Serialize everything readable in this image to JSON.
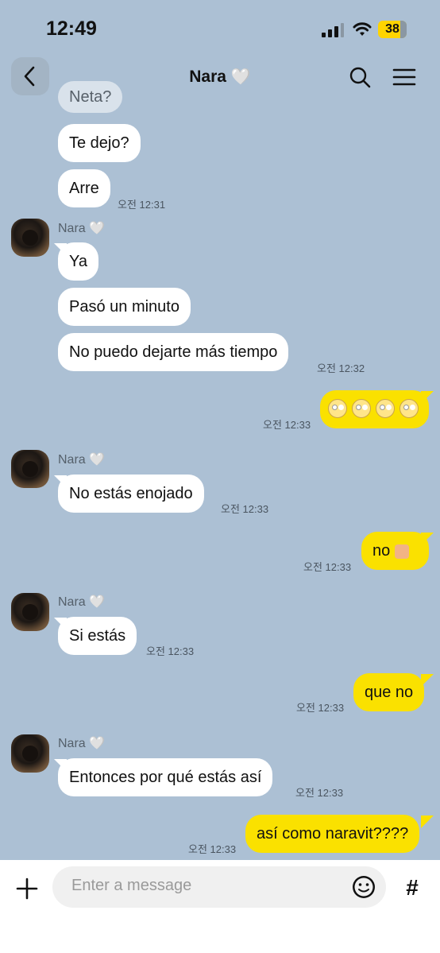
{
  "status": {
    "time": "12:49",
    "battery": "38"
  },
  "header": {
    "title": "Nara",
    "heart": "🤍"
  },
  "contact": {
    "name": "Nara",
    "heart": "🤍"
  },
  "messages": [
    {
      "text": "Neta?"
    },
    {
      "text": "Te dejo?"
    },
    {
      "text": "Arre",
      "time": "오전 12:31"
    },
    {
      "text": "Ya"
    },
    {
      "text": "Pasó un minuto"
    },
    {
      "text": "No puedo dejarte más tiempo",
      "time": "오전 12:32"
    },
    {
      "text": "🙄🙄🙄🙄",
      "time": "오전 12:33"
    },
    {
      "text": "No estás enojado",
      "time": "오전 12:33"
    },
    {
      "text": "no",
      "emoji": "👎",
      "time": "오전 12:33"
    },
    {
      "text": "Si estás",
      "time": "오전 12:33"
    },
    {
      "text": "que no",
      "time": "오전 12:33"
    },
    {
      "text": "Entonces por qué estás así",
      "time": "오전 12:33"
    },
    {
      "text": "así como naravit????",
      "time": "오전 12:33"
    }
  ],
  "input": {
    "placeholder": "Enter a message"
  },
  "colors": {
    "background": "#acc0d4",
    "outgoing": "#fae100",
    "incoming": "#ffffff"
  }
}
